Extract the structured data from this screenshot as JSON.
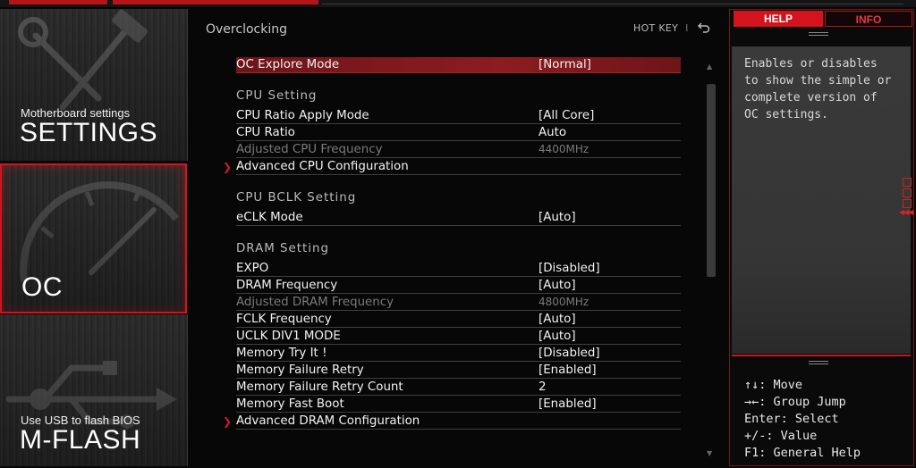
{
  "left_nav": {
    "settings": {
      "subtitle": "Motherboard settings",
      "title": "SETTINGS"
    },
    "oc": {
      "title": "OC"
    },
    "mflash": {
      "subtitle": "Use USB to flash BIOS",
      "title": "M-FLASH"
    }
  },
  "header": {
    "section_title": "Overclocking",
    "hotkey_label": "HOT KEY",
    "hotkey_separator": "I"
  },
  "settings_list": {
    "oc_explore": {
      "label": "OC Explore Mode",
      "value": "[Normal]"
    },
    "cpu_group": "CPU Setting",
    "cpu_ratio_apply": {
      "label": "CPU Ratio Apply Mode",
      "value": "[All Core]"
    },
    "cpu_ratio": {
      "label": "CPU Ratio",
      "value": "Auto"
    },
    "adj_cpu_freq": {
      "label": "Adjusted CPU Frequency",
      "value": "4400MHz"
    },
    "adv_cpu": {
      "label": "Advanced CPU Configuration"
    },
    "bclk_group": "CPU BCLK Setting",
    "eclk": {
      "label": "eCLK Mode",
      "value": "[Auto]"
    },
    "dram_group": "DRAM Setting",
    "expo": {
      "label": "EXPO",
      "value": "[Disabled]"
    },
    "dram_freq": {
      "label": "DRAM Frequency",
      "value": "[Auto]"
    },
    "adj_dram_freq": {
      "label": "Adjusted DRAM Frequency",
      "value": "4800MHz"
    },
    "fclk": {
      "label": "FCLK Frequency",
      "value": "[Auto]"
    },
    "uclk": {
      "label": "UCLK DIV1 MODE",
      "value": "[Auto]"
    },
    "mem_try": {
      "label": "Memory Try It !",
      "value": "[Disabled]"
    },
    "mem_fail_retry": {
      "label": "Memory Failure Retry",
      "value": "[Enabled]"
    },
    "mem_fail_count": {
      "label": "Memory Failure Retry Count",
      "value": "2"
    },
    "mem_fast_boot": {
      "label": "Memory Fast Boot",
      "value": "[Enabled]"
    },
    "adv_dram": {
      "label": "Advanced DRAM Configuration"
    }
  },
  "right_panel": {
    "tab_help": "HELP",
    "tab_info": "INFO",
    "help_text": "Enables or disables to show the simple or complete version of OC settings.",
    "keys": {
      "move": "↑↓: Move",
      "group_jump": "→←: Group Jump",
      "select": "Enter: Select",
      "value": "+/-: Value",
      "general_help": "F1: General Help"
    }
  },
  "colors": {
    "accent_red": "#d4141c",
    "selected_row": "#8c1c20",
    "dim_text": "#7a7a7a"
  }
}
